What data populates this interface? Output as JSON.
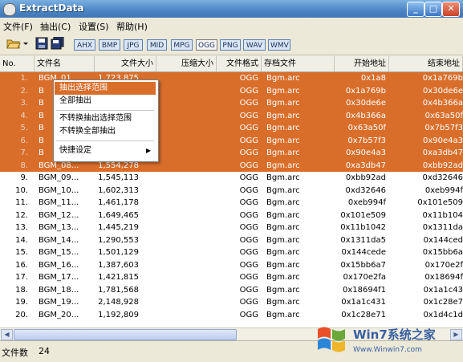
{
  "window": {
    "title": "ExtractData",
    "controls": [
      "_",
      "□",
      "✕"
    ]
  },
  "menu": [
    {
      "label": "文件(F)"
    },
    {
      "label": "抽出(C)"
    },
    {
      "label": "设置(S)"
    },
    {
      "label": "帮助(H)"
    }
  ],
  "toolbar": {
    "icons": [
      "open-folder-icon",
      "dropdown-arrow-icon",
      "save-icon",
      "save-all-icon"
    ],
    "formats": [
      "AHX",
      "BMP",
      "JPG",
      "MID",
      "MPG",
      "OGG",
      "PNG",
      "WAV",
      "WMV"
    ],
    "active_format": "OGG"
  },
  "columns": [
    "No.",
    "文件名",
    "文件大小",
    "压缩大小",
    "文件格式",
    "存档文件",
    "开始地址",
    "结束地址"
  ],
  "rows": [
    {
      "no": "1.",
      "name": "BGM_01",
      "size": "1,723,875",
      "comp": "",
      "fmt": "OGG",
      "arc": "Bgm.arc",
      "start": "0x1a8",
      "end": "0x1a769b",
      "selected": true
    },
    {
      "no": "2.",
      "name": "B",
      "size": "",
      "comp": "",
      "fmt": "OGG",
      "arc": "Bgm.arc",
      "start": "0x1a769b",
      "end": "0x30de6e",
      "selected": true
    },
    {
      "no": "3.",
      "name": "B",
      "size": "",
      "comp": "",
      "fmt": "OGG",
      "arc": "Bgm.arc",
      "start": "0x30de6e",
      "end": "0x4b366a",
      "selected": true
    },
    {
      "no": "4.",
      "name": "B",
      "size": "",
      "comp": "",
      "fmt": "OGG",
      "arc": "Bgm.arc",
      "start": "0x4b366a",
      "end": "0x63a50f",
      "selected": true
    },
    {
      "no": "5.",
      "name": "B",
      "size": "",
      "comp": "",
      "fmt": "OGG",
      "arc": "Bgm.arc",
      "start": "0x63a50f",
      "end": "0x7b57f3",
      "selected": true
    },
    {
      "no": "6.",
      "name": "B",
      "size": "",
      "comp": "",
      "fmt": "OGG",
      "arc": "Bgm.arc",
      "start": "0x7b57f3",
      "end": "0x90e4a3",
      "selected": true
    },
    {
      "no": "7.",
      "name": "B",
      "size": "",
      "comp": "",
      "fmt": "OGG",
      "arc": "Bgm.arc",
      "start": "0x90e4a3",
      "end": "0xa3db47",
      "selected": true
    },
    {
      "no": "8.",
      "name": "BGM_08...",
      "size": "1,554,278",
      "comp": "",
      "fmt": "OGG",
      "arc": "Bgm.arc",
      "start": "0xa3db47",
      "end": "0xbb92ad",
      "selected": true
    },
    {
      "no": "9.",
      "name": "BGM_09...",
      "size": "1,545,113",
      "comp": "",
      "fmt": "OGG",
      "arc": "Bgm.arc",
      "start": "0xbb92ad",
      "end": "0xd32646",
      "selected": false
    },
    {
      "no": "10.",
      "name": "BGM_10...",
      "size": "1,602,313",
      "comp": "",
      "fmt": "OGG",
      "arc": "Bgm.arc",
      "start": "0xd32646",
      "end": "0xeb994f",
      "selected": false
    },
    {
      "no": "11.",
      "name": "BGM_11...",
      "size": "1,461,178",
      "comp": "",
      "fmt": "OGG",
      "arc": "Bgm.arc",
      "start": "0xeb994f",
      "end": "0x101e509",
      "selected": false
    },
    {
      "no": "12.",
      "name": "BGM_12...",
      "size": "1,649,465",
      "comp": "",
      "fmt": "OGG",
      "arc": "Bgm.arc",
      "start": "0x101e509",
      "end": "0x11b104",
      "selected": false
    },
    {
      "no": "13.",
      "name": "BGM_13...",
      "size": "1,445,219",
      "comp": "",
      "fmt": "OGG",
      "arc": "Bgm.arc",
      "start": "0x11b1042",
      "end": "0x1311da",
      "selected": false
    },
    {
      "no": "14.",
      "name": "BGM_14...",
      "size": "1,290,553",
      "comp": "",
      "fmt": "OGG",
      "arc": "Bgm.arc",
      "start": "0x1311da5",
      "end": "0x144ced",
      "selected": false
    },
    {
      "no": "15.",
      "name": "BGM_15...",
      "size": "1,501,129",
      "comp": "",
      "fmt": "OGG",
      "arc": "Bgm.arc",
      "start": "0x144cede",
      "end": "0x15bb6a",
      "selected": false
    },
    {
      "no": "16.",
      "name": "BGM_16...",
      "size": "1,387,603",
      "comp": "",
      "fmt": "OGG",
      "arc": "Bgm.arc",
      "start": "0x15bb6a7",
      "end": "0x170e2f",
      "selected": false
    },
    {
      "no": "17.",
      "name": "BGM_17...",
      "size": "1,421,815",
      "comp": "",
      "fmt": "OGG",
      "arc": "Bgm.arc",
      "start": "0x170e2fa",
      "end": "0x18694f",
      "selected": false
    },
    {
      "no": "18.",
      "name": "BGM_18...",
      "size": "1,781,568",
      "comp": "",
      "fmt": "OGG",
      "arc": "Bgm.arc",
      "start": "0x18694f1",
      "end": "0x1a1c43",
      "selected": false
    },
    {
      "no": "19.",
      "name": "BGM_19...",
      "size": "2,148,928",
      "comp": "",
      "fmt": "OGG",
      "arc": "Bgm.arc",
      "start": "0x1a1c431",
      "end": "0x1c28e7",
      "selected": false
    },
    {
      "no": "20.",
      "name": "BGM_20...",
      "size": "1,192,809",
      "comp": "",
      "fmt": "OGG",
      "arc": "Bgm.arc",
      "start": "0x1c28e71",
      "end": "0x1d4c1d",
      "selected": false
    }
  ],
  "context_menu": {
    "items": [
      {
        "label": "抽出选择范围",
        "highlighted": true,
        "submenu": false
      },
      {
        "label": "全部抽出",
        "highlighted": false,
        "submenu": false
      },
      {
        "label": "不转换抽出选择范围",
        "highlighted": false,
        "submenu": false
      },
      {
        "label": "不转换全部抽出",
        "highlighted": false,
        "submenu": false
      },
      {
        "label": "快捷设定",
        "highlighted": false,
        "submenu": true
      }
    ]
  },
  "status": {
    "label": "文件数",
    "value": "24"
  },
  "watermark": {
    "line1": "Win7系统之家",
    "line2": "Www.Winwin7.com"
  },
  "colors": {
    "selection": "#d96e2b",
    "title_bar": "#4f88c6",
    "window_bg": "#ece9d8"
  }
}
